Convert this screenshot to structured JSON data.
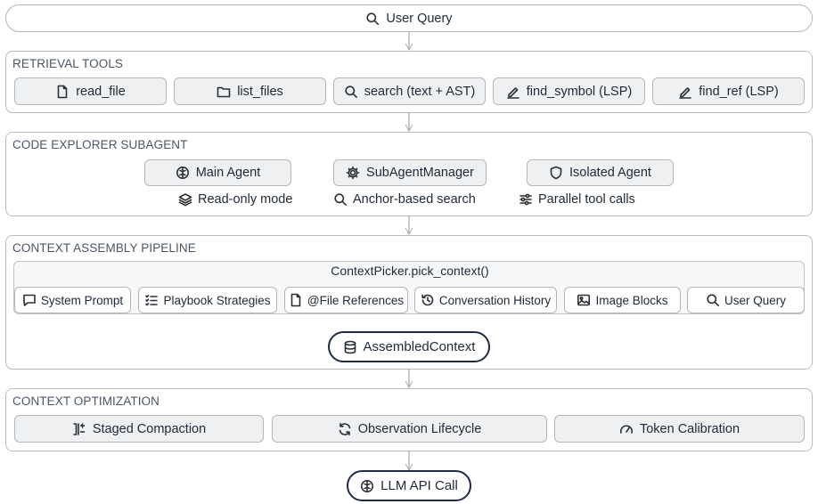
{
  "top_query": {
    "label": "User Query",
    "icon": "search-icon"
  },
  "retrieval": {
    "title": "RETRIEVAL TOOLS",
    "tools": [
      {
        "label": "read_file",
        "icon": "file-icon"
      },
      {
        "label": "list_files",
        "icon": "folder-icon"
      },
      {
        "label": "search (text + AST)",
        "icon": "search-icon"
      },
      {
        "label": "find_symbol (LSP)",
        "icon": "pen-icon"
      },
      {
        "label": "find_ref (LSP)",
        "icon": "pen-icon"
      }
    ]
  },
  "explorer": {
    "title": "CODE EXPLORER SUBAGENT",
    "main_agent": "Main Agent",
    "manager": "SubAgentManager",
    "isolated": "Isolated Agent",
    "features": [
      {
        "label": "Read-only mode",
        "icon": "layers-icon"
      },
      {
        "label": "Anchor-based search",
        "icon": "search-icon"
      },
      {
        "label": "Parallel tool calls",
        "icon": "sliders-icon"
      }
    ]
  },
  "assembly": {
    "title": "CONTEXT ASSEMBLY PIPELINE",
    "picker": "ContextPicker.pick_context()",
    "sources": [
      {
        "label": "System Prompt",
        "icon": "chat-icon"
      },
      {
        "label": "Playbook Strategies",
        "icon": "list-icon"
      },
      {
        "label": "@File References",
        "icon": "file-icon"
      },
      {
        "label": "Conversation History",
        "icon": "history-icon"
      },
      {
        "label": "Image Blocks",
        "icon": "image-icon"
      },
      {
        "label": "User Query",
        "icon": "search-icon"
      }
    ],
    "assembled": "AssembledContext"
  },
  "optimization": {
    "title": "CONTEXT OPTIMIZATION",
    "items": [
      {
        "label": "Staged Compaction",
        "icon": "compaction-icon"
      },
      {
        "label": "Observation Lifecycle",
        "icon": "refresh-icon"
      },
      {
        "label": "Token Calibration",
        "icon": "gauge-icon"
      }
    ]
  },
  "llm": {
    "label": "LLM API Call",
    "icon": "brain-icon"
  },
  "colors": {
    "border": "#b9bdc2",
    "box_fill": "#eef0f2",
    "pill_border": "#1f2a44",
    "arrow": "#9aa0a6"
  }
}
